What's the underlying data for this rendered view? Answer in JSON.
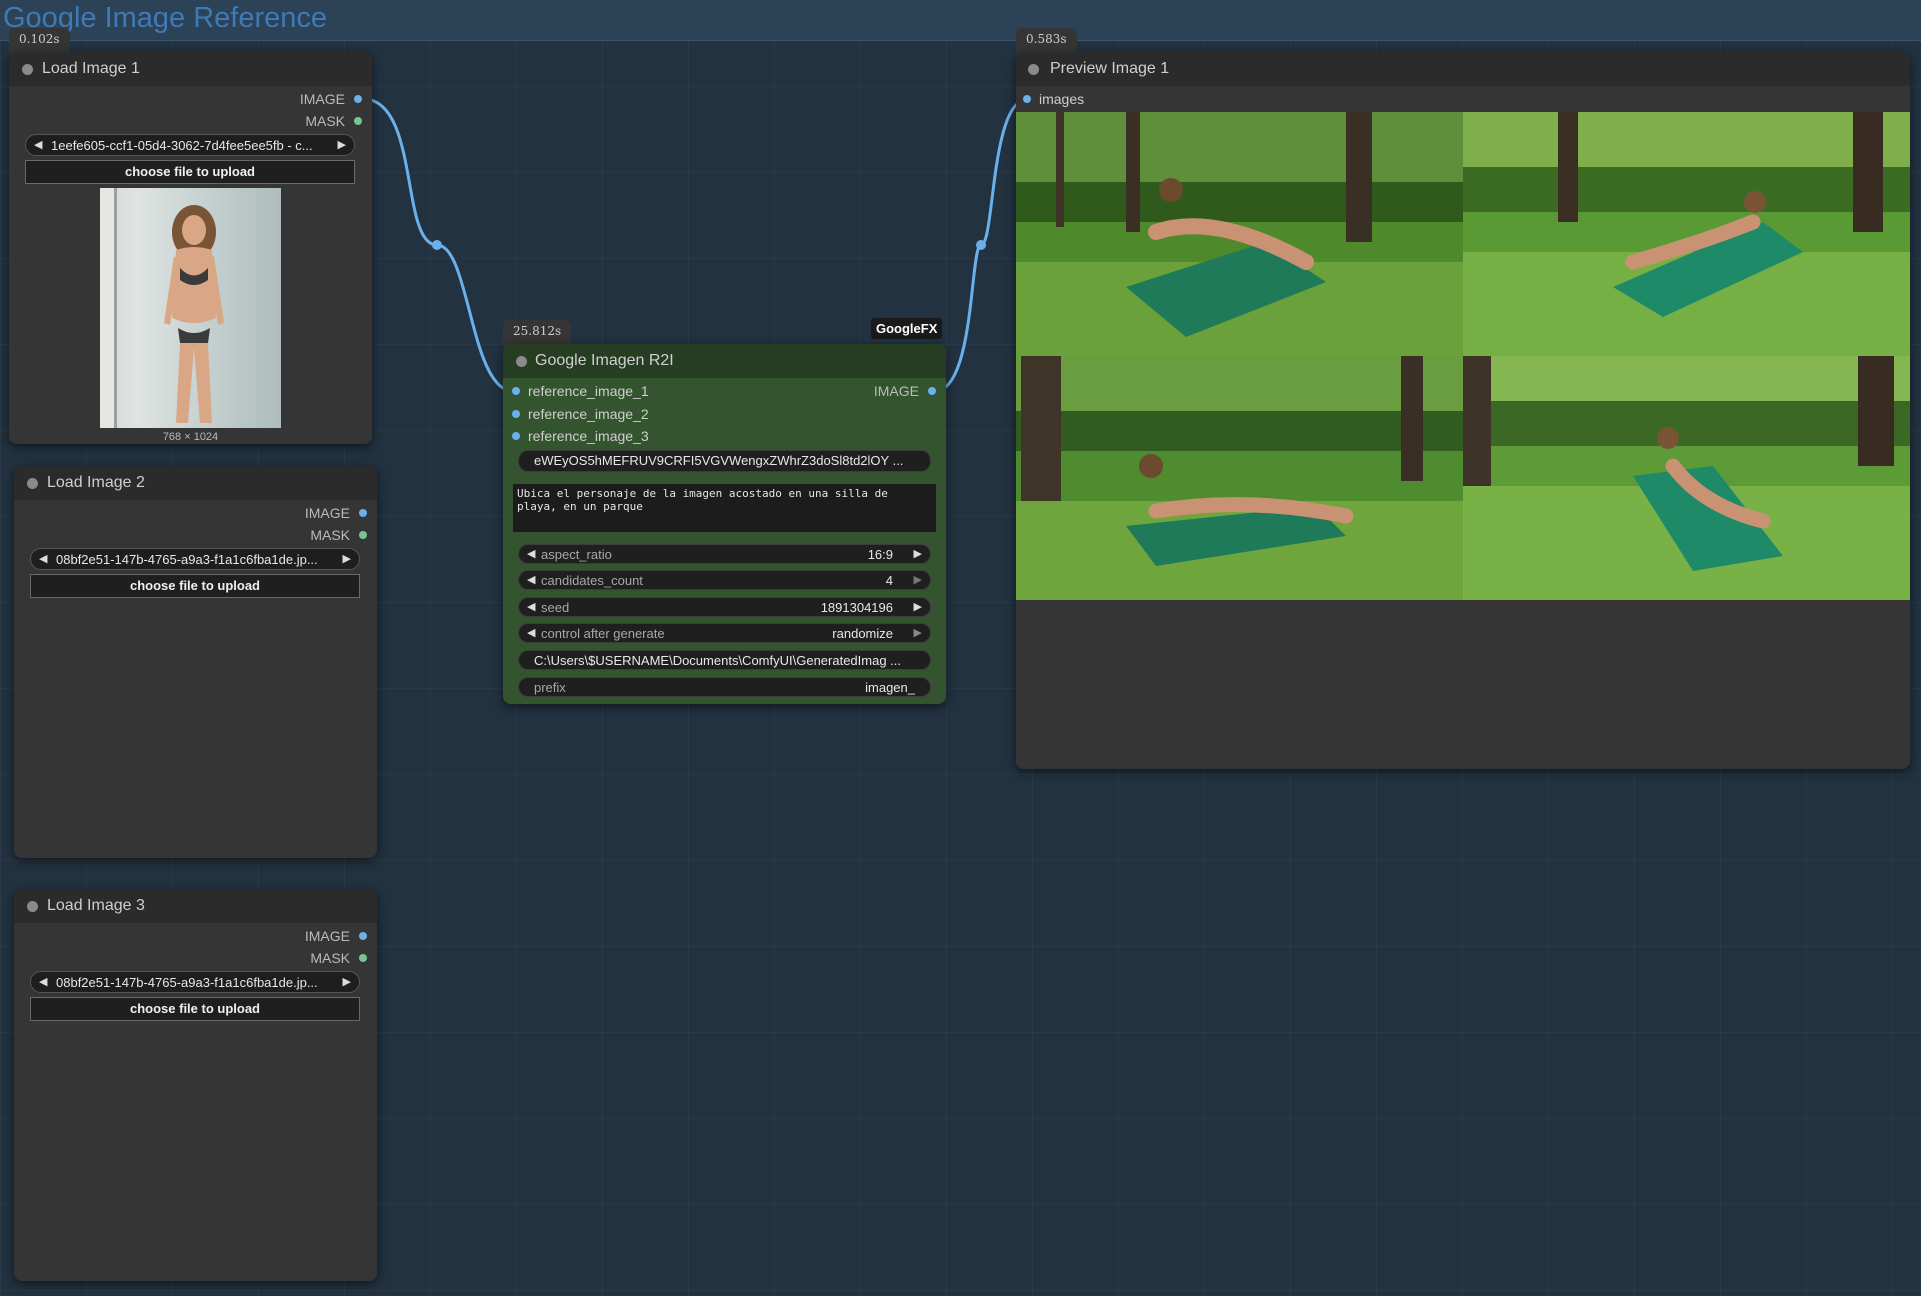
{
  "group": {
    "title": "Google Image Reference"
  },
  "colors": {
    "link_blue": "#6ab0ea",
    "mask_green": "#76c58e",
    "google_node": "#34542f"
  },
  "load1": {
    "time": "0.102s",
    "title": "Load Image 1",
    "out_image": "IMAGE",
    "out_mask": "MASK",
    "file": "1eefe605-ccf1-05d4-3062-7d4fee5ee5fb - c...",
    "upload": "choose file to upload",
    "dims": "768 × 1024"
  },
  "load2": {
    "title": "Load Image 2",
    "out_image": "IMAGE",
    "out_mask": "MASK",
    "file": "08bf2e51-147b-4765-a9a3-f1a1c6fba1de.jp...",
    "upload": "choose file to upload"
  },
  "load3": {
    "title": "Load Image 3",
    "out_image": "IMAGE",
    "out_mask": "MASK",
    "file": "08bf2e51-147b-4765-a9a3-f1a1c6fba1de.jp...",
    "upload": "choose file to upload"
  },
  "imagen": {
    "time": "25.812s",
    "badge": "GoogleFX",
    "title": "Google Imagen R2I",
    "inputs": [
      "reference_image_1",
      "reference_image_2",
      "reference_image_3"
    ],
    "output": "IMAGE",
    "api_key": "eWEyOS5hMEFRUV9CRFI5VGVWengxZWhrZ3doSl8td2lOY ...",
    "prompt": "Ubica el personaje de la imagen acostado en una silla de playa, en un parque",
    "aspect_ratio": {
      "label": "aspect_ratio",
      "value": "16:9"
    },
    "candidates_count": {
      "label": "candidates_count",
      "value": "4"
    },
    "seed": {
      "label": "seed",
      "value": "1891304196"
    },
    "control": {
      "label": "control after generate",
      "value": "randomize"
    },
    "path": "C:\\Users\\$USERNAME\\Documents\\ComfyUI\\GeneratedImag ...",
    "prefix": {
      "label": "prefix",
      "value": "imagen_"
    }
  },
  "preview": {
    "time": "0.583s",
    "title": "Preview Image 1",
    "input": "images"
  }
}
